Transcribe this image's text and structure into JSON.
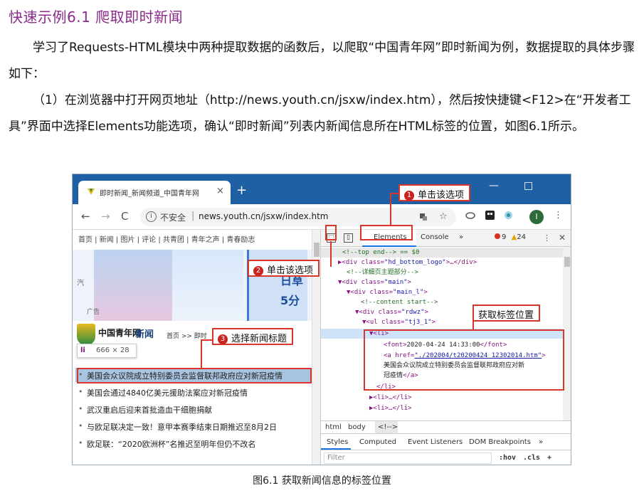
{
  "heading": "快速示例6.1 爬取即时新闻",
  "paragraph1": "学习了Requests-HTML模块中两种提取数据的函数后，以爬取“中国青年网”即时新闻为例，数据提取的具体步骤如下：",
  "paragraph2": "（1）在浏览器中打开网页地址（http://news.youth.cn/jsxw/index.htm），然后按快捷键<F12>在“开发者工具”界面中选择Elements功能选项，确认“即时新闻”列表内新闻信息所在HTML标签的位置，如图6.1所示。",
  "figure_caption": "图6.1  获取新闻信息的标签位置",
  "browser": {
    "tab_title": "即时新闻_新闻频道_中国青年网",
    "tab_close": "×",
    "new_tab": "+",
    "minimize": "—",
    "maximize": "□",
    "insecure_label": "不安全",
    "url": "news.youth.cn/jsxw/index.htm",
    "avatar_letter": "I",
    "back": "←",
    "forward": "→",
    "reload": "C",
    "url_info": "i",
    "url_sep": "|",
    "star": "☆",
    "menu": "⋮"
  },
  "webpage": {
    "nav": "首页  |  新闻  |  图片  |  评论  |  共青团  |  青年之声  |  青春励志",
    "banner_side": "汽",
    "banner_ad": "广告",
    "banner_text_1": "日草",
    "banner_text_2": "5分",
    "logo_text": "中国青年网",
    "logo_sub": "新闻",
    "breadcrumb": "首页  >>  即时",
    "tooltip_tag": "li",
    "tooltip_size": "666 × 28",
    "news": [
      "美国会众议院成立特别委员会监督联邦政府应对新冠疫情",
      "美国会通过4840亿美元援助法案应对新冠疫情",
      "武汉重启后迎来首批造血干细胞捐献",
      "与欧足联决定一致！意甲本赛季结束日期推迟至8月2日",
      "欧足联：“2020欧洲杯”名推迟至明年但仍不改名"
    ]
  },
  "devtools": {
    "tabs": [
      "Elements",
      "Console",
      "»"
    ],
    "errors": "9",
    "warnings": "24",
    "warning_icon": "▲",
    "inspect_icon": "⬚",
    "device_icon": "▯",
    "menu_icon": "⋮",
    "close_icon": "✕",
    "dom": {
      "l1": "<!--top end--> == $0",
      "l2a": "▶<div class=",
      "l2b": "\"hd_bottom_logo\"",
      "l2c": ">…</div>",
      "l3": "<!--详细页主题部分-->",
      "l4a": "▼<div class=",
      "l4b": "\"main\"",
      "l4c": ">",
      "l5a": "▼<div class=",
      "l5b": "\"main_l\"",
      "l5c": ">",
      "l6": "<!--content start-->",
      "l7a": "▼<div class=",
      "l7b": "\"rdwz\"",
      "l7c": ">",
      "l8a": "▼<ul class=",
      "l8b": "\"tj3_1\"",
      "l8c": ">",
      "l9": "▼<li>",
      "l10a": "<font>",
      "l10b": "2020-04-24 14:33:00",
      "l10c": "</font>",
      "l11a": "<a href=",
      "l11b": "\"./202004/t20200424_12302014.htm\"",
      "l11c": ">",
      "l12": "美国会众议院成立特别委员会监督联邦政府应对新",
      "l13a": "冠疫情",
      "l13b": "</a>",
      "l14": "</li>",
      "l15": "▶<li>…</li>",
      "l16": "▶<li>…</li>"
    },
    "breadcrumb": [
      "html",
      "body",
      "<!-->"
    ],
    "subtabs": [
      "Styles",
      "Computed",
      "Event Listeners",
      "DOM Breakpoints",
      "»"
    ],
    "filter_placeholder": "Filter",
    "filter_hov": ":hov",
    "filter_cls": ".cls",
    "filter_add": "+"
  },
  "annotations": {
    "step1_num": "1",
    "step1": "单击该选项",
    "step2_num": "2",
    "step2": "单击该选项",
    "step3_num": "3",
    "step3": "选择新闻标题",
    "get_tag": "获取标签位置"
  },
  "colors": {
    "heading": "#8a2a8a",
    "annotation_red": "#d9362b",
    "browser_tabbar": "#1f5fa3",
    "highlight_row": "#a8c4e0"
  }
}
